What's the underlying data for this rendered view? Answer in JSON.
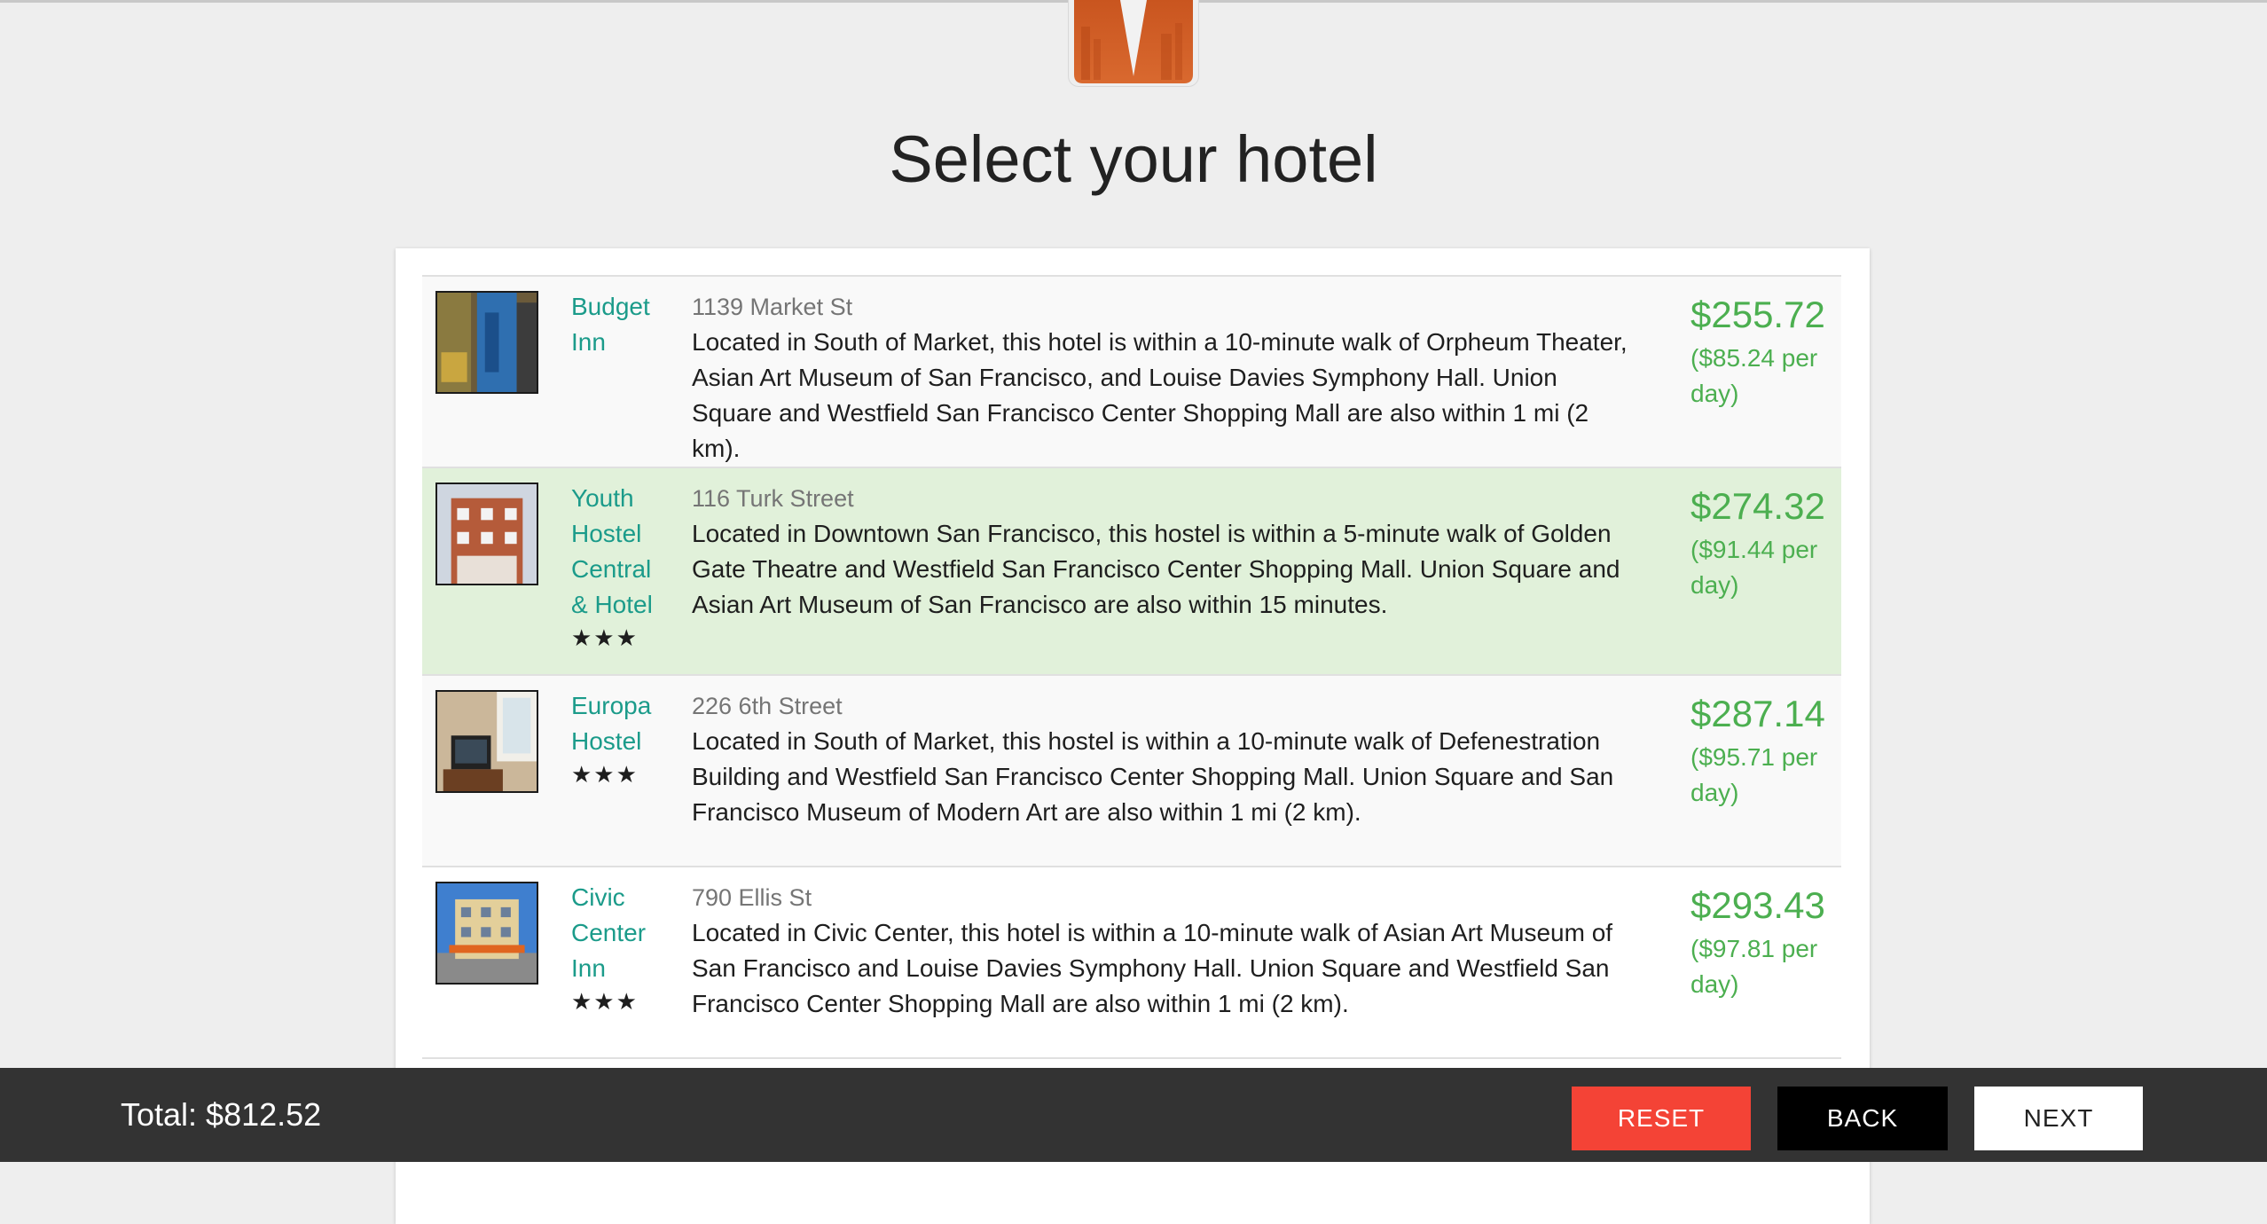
{
  "page": {
    "title": "Select your hotel"
  },
  "colors": {
    "accent_teal": "#1b9b8a",
    "price_green": "#4caf50",
    "selected_row": "#e1f1da",
    "reset_red": "#f44336",
    "footer_bg": "#333333",
    "logo_orange": "#d2622c"
  },
  "hotels": [
    {
      "name_lines": [
        "Budget",
        "Inn"
      ],
      "stars": "",
      "address": "1139 Market St",
      "description": "Located in South of Market, this hotel is within a 10-minute walk of Orpheum Theater, Asian Art Museum of San Francisco, and Louise Davies Symphony Hall. Union Square and Westfield San Francisco Center Shopping Mall are also within 1 mi (2 km).",
      "price": "$255.72",
      "per_day": "($85.24 per day)",
      "selected": false,
      "thumb_icon": "hotel-photo-icon"
    },
    {
      "name_lines": [
        "Youth",
        "Hostel",
        "Central",
        "& Hotel"
      ],
      "stars": "★★★",
      "address": "116 Turk Street",
      "description": "Located in Downtown San Francisco, this hostel is within a 5-minute walk of Golden Gate Theatre and Westfield San Francisco Center Shopping Mall. Union Square and Asian Art Museum of San Francisco are also within 15 minutes.",
      "price": "$274.32",
      "per_day": "($91.44 per day)",
      "selected": true,
      "thumb_icon": "hotel-photo-icon"
    },
    {
      "name_lines": [
        "Europa",
        "Hostel"
      ],
      "stars": "★★★",
      "address": "226 6th Street",
      "description": "Located in South of Market, this hostel is within a 10-minute walk of Defenestration Building and Westfield San Francisco Center Shopping Mall. Union Square and San Francisco Museum of Modern Art are also within 1 mi (2 km).",
      "price": "$287.14",
      "per_day": "($95.71 per day)",
      "selected": false,
      "thumb_icon": "hotel-photo-icon"
    },
    {
      "name_lines": [
        "Civic",
        "Center",
        "Inn"
      ],
      "stars": "★★★",
      "address": "790 Ellis St",
      "description": "Located in Civic Center, this hotel is within a 10-minute walk of Asian Art Museum of San Francisco and Louise Davies Symphony Hall. Union Square and Westfield San Francisco Center Shopping Mall are also within 1 mi (2 km).",
      "price": "$293.43",
      "per_day": "($97.81 per day)",
      "selected": false,
      "thumb_icon": "hotel-photo-icon"
    }
  ],
  "footer": {
    "total": "Total: $812.52",
    "reset_label": "RESET",
    "back_label": "BACK",
    "next_label": "NEXT"
  }
}
